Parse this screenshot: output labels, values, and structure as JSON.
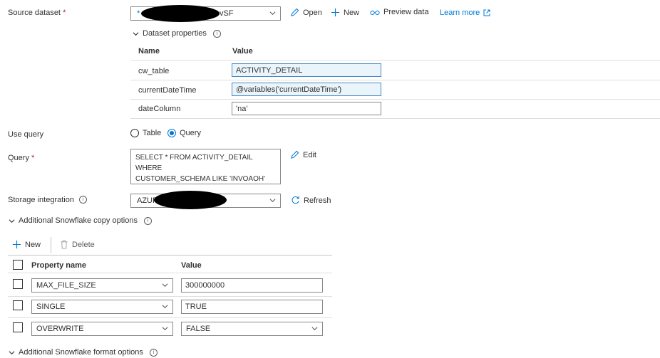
{
  "source_dataset": {
    "label": "Source dataset",
    "required_mark": "*",
    "value_prefix": "*",
    "value_suffix": "vSF",
    "open_label": "Open",
    "new_label": "New",
    "preview_label": "Preview data",
    "learn_more_label": "Learn more"
  },
  "dataset_properties": {
    "title": "Dataset properties",
    "col_name": "Name",
    "col_value": "Value",
    "rows": [
      {
        "name": "cw_table",
        "value": "ACTIVITY_DETAIL"
      },
      {
        "name": "currentDateTime",
        "value": "@variables('currentDateTime')"
      },
      {
        "name": "dateColumn",
        "value": "'na'"
      }
    ]
  },
  "use_query": {
    "label": "Use query",
    "options": [
      "Table",
      "Query"
    ],
    "selected": "Query"
  },
  "query": {
    "label": "Query",
    "required_mark": "*",
    "line1": "SELECT * FROM ACTIVITY_DETAIL WHERE",
    "line2": "CUSTOMER_SCHEMA LIKE 'INVOAOH'",
    "edit_label": "Edit"
  },
  "storage_integration": {
    "label": "Storage integration",
    "value_prefix": "AZUR",
    "refresh_label": "Refresh"
  },
  "copy_options": {
    "title": "Additional Snowflake copy options",
    "new_label": "New",
    "delete_label": "Delete",
    "col_property": "Property name",
    "col_value": "Value",
    "rows": [
      {
        "property": "MAX_FILE_SIZE",
        "value": "300000000"
      },
      {
        "property": "SINGLE",
        "value": "TRUE"
      },
      {
        "property": "OVERWRITE",
        "value": "FALSE"
      }
    ]
  },
  "format_options": {
    "title": "Additional Snowflake format options"
  },
  "colors": {
    "accent": "#0078d4",
    "highlight_bg": "#eaf4fb",
    "required": "#a4262c"
  }
}
